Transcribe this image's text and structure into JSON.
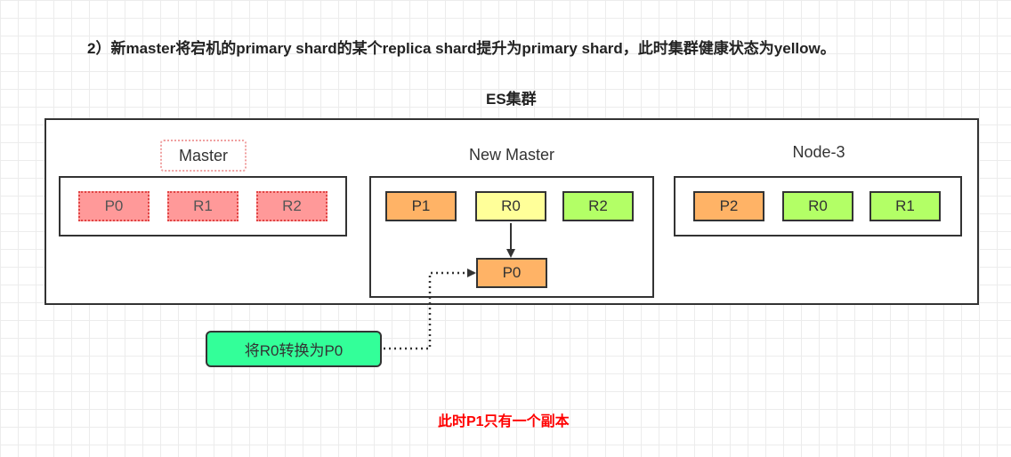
{
  "heading": "2）新master将宕机的primary shard的某个replica shard提升为primary shard，此时集群健康状态为yellow。",
  "cluster_title": "ES集群",
  "nodes": {
    "master": {
      "label": "Master",
      "shards": [
        "P0",
        "R1",
        "R2"
      ]
    },
    "new_master": {
      "label": "New Master",
      "shards": [
        "P1",
        "R0",
        "R2"
      ],
      "promoted": "P0"
    },
    "node3": {
      "label": "Node-3",
      "shards": [
        "P2",
        "R0",
        "R1"
      ]
    }
  },
  "action_note": "将R0转换为P0",
  "footer_note": "此时P1只有一个副本",
  "colors": {
    "primary": "#ffb366",
    "replica_yellow": "#ffff99",
    "replica_green": "#b3ff66",
    "dead": "#ff9999",
    "action": "#33ff99",
    "alert": "#ff0000"
  }
}
